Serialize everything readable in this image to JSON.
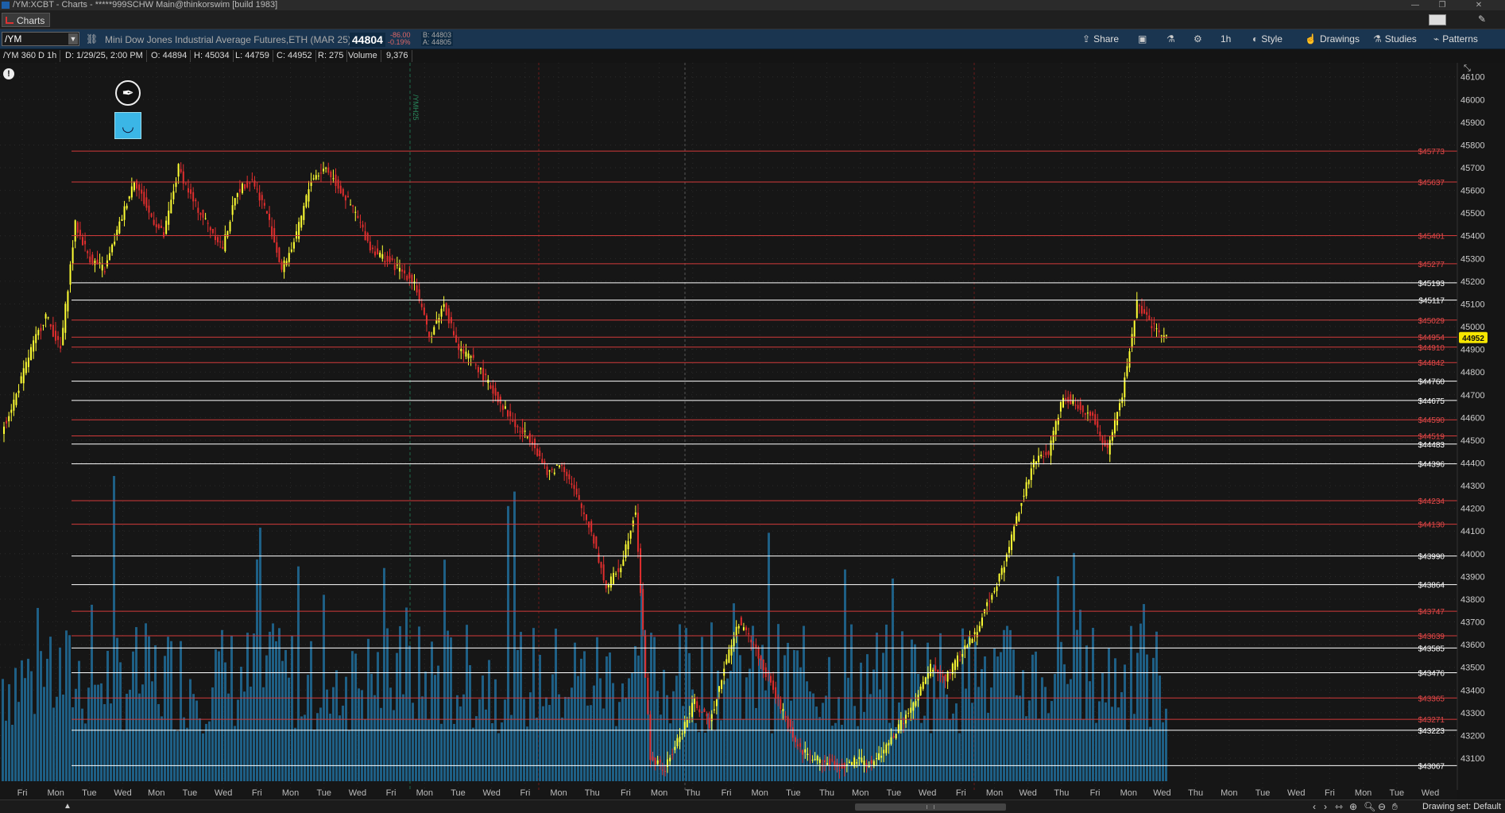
{
  "window": {
    "title": "/YM:XCBT - Charts - *****999SCHW Main@thinkorswim [build 1983]",
    "tab_label": "Charts"
  },
  "toolbar": {
    "symbol": "/YM",
    "description": "Mini Dow Jones Industrial Average Futures,ETH (MAR 25)",
    "last": "44804",
    "net_change": "-86.00",
    "pct_change": "-0.19%",
    "bid": "B: 44803",
    "ask": "A: 44805",
    "share_label": "Share",
    "timeframe_label": "1h",
    "style_label": "Style",
    "drawings_label": "Drawings",
    "studies_label": "Studies",
    "patterns_label": "Patterns"
  },
  "infobar": {
    "period": "/YM 360 D 1h",
    "date": "D: 1/29/25, 2:00 PM",
    "open": "O: 44894",
    "high": "H: 45034",
    "low": "L: 44759",
    "close": "C: 44952",
    "range": "R: 275",
    "volume_label": "Volume",
    "volume": "9,376"
  },
  "footer": {
    "drawing_set": "Drawing set: Default"
  },
  "colors": {
    "background": "#161616",
    "support_line": "#ffffff",
    "resistance_line": "#d23a3a",
    "up_candle": "#ffff33",
    "down_candle": "#e02e2e",
    "volume": "#1e5f85",
    "price_bubble": "#f7e600"
  },
  "chart_data": {
    "type": "candlestick",
    "y_axis": {
      "min": 43030,
      "max": 46120,
      "ticks": [
        46100,
        46000,
        45900,
        45800,
        45700,
        45600,
        45500,
        45400,
        45300,
        45200,
        45100,
        45000,
        44900,
        44800,
        44700,
        44600,
        44500,
        44400,
        44300,
        44200,
        44100,
        44000,
        43900,
        43800,
        43700,
        43600,
        43500,
        43400,
        43300,
        43200,
        43100
      ],
      "tick_labels": [
        "46100",
        "46000",
        "45900",
        "45800",
        "45700",
        "45600",
        "45500",
        "45400",
        "45300",
        "45200",
        "45100",
        "45000",
        "44900",
        "44800",
        "44700",
        "44600",
        "44500",
        "44400",
        "44300",
        "44200",
        "44100",
        "44000",
        "43900",
        "43800",
        "43700",
        "43600",
        "43500",
        "43400",
        "43300",
        "43200",
        "43100"
      ]
    },
    "x_labels": [
      "Fri",
      "Mon",
      "Tue",
      "Wed",
      "Mon",
      "Tue",
      "Wed",
      "Fri",
      "Mon",
      "Tue",
      "Wed",
      "Fri",
      "Mon",
      "Tue",
      "Wed",
      "Fri",
      "Mon",
      "Thu",
      "Fri",
      "Mon",
      "Thu",
      "Fri",
      "Mon",
      "Tue",
      "Thu",
      "Mon",
      "Tue",
      "Wed",
      "Fri",
      "Mon",
      "Wed",
      "Thu",
      "Fri",
      "Mon",
      "Wed",
      "Thu",
      "Mon",
      "Tue",
      "Wed",
      "Fri",
      "Mon",
      "Tue",
      "Wed"
    ],
    "current_price_bubble": 44952,
    "expiration_marker": "/YMH25",
    "key_levels": [
      {
        "value": 45773,
        "label": "$45773",
        "kind": "resistance"
      },
      {
        "value": 45637,
        "label": "$45637",
        "kind": "resistance"
      },
      {
        "value": 45401,
        "label": "$45401",
        "kind": "resistance"
      },
      {
        "value": 45277,
        "label": "$45277",
        "kind": "resistance"
      },
      {
        "value": 45193,
        "label": "$45193",
        "kind": "support"
      },
      {
        "value": 45117,
        "label": "$45117",
        "kind": "support"
      },
      {
        "value": 45029,
        "label": "$45029",
        "kind": "resistance"
      },
      {
        "value": 44954,
        "label": "$44954",
        "kind": "resistance"
      },
      {
        "value": 44910,
        "label": "$44910",
        "kind": "resistance"
      },
      {
        "value": 44842,
        "label": "$44842",
        "kind": "resistance"
      },
      {
        "value": 44760,
        "label": "$44760",
        "kind": "support"
      },
      {
        "value": 44675,
        "label": "$44675",
        "kind": "support"
      },
      {
        "value": 44590,
        "label": "$44590",
        "kind": "resistance"
      },
      {
        "value": 44519,
        "label": "$44519",
        "kind": "resistance"
      },
      {
        "value": 44483,
        "label": "$44483",
        "kind": "support"
      },
      {
        "value": 44396,
        "label": "$44396",
        "kind": "support"
      },
      {
        "value": 44234,
        "label": "$44234",
        "kind": "resistance"
      },
      {
        "value": 44130,
        "label": "$44130",
        "kind": "resistance"
      },
      {
        "value": 43990,
        "label": "$43990",
        "kind": "support"
      },
      {
        "value": 43864,
        "label": "$43864",
        "kind": "support"
      },
      {
        "value": 43747,
        "label": "$43747",
        "kind": "resistance"
      },
      {
        "value": 43639,
        "label": "$43639",
        "kind": "resistance"
      },
      {
        "value": 43585,
        "label": "$43585",
        "kind": "support"
      },
      {
        "value": 43476,
        "label": "$43476",
        "kind": "support"
      },
      {
        "value": 43365,
        "label": "$43365",
        "kind": "resistance"
      },
      {
        "value": 43271,
        "label": "$43271",
        "kind": "resistance"
      },
      {
        "value": 43223,
        "label": "$43223",
        "kind": "support"
      },
      {
        "value": 43067,
        "label": "$43067",
        "kind": "support"
      }
    ],
    "price_path": [
      44540,
      44700,
      44900,
      45050,
      44900,
      45450,
      45300,
      45250,
      45450,
      45650,
      45500,
      45400,
      45700,
      45550,
      45450,
      45350,
      45600,
      45650,
      45500,
      45250,
      45400,
      45650,
      45700,
      45600,
      45500,
      45350,
      45300,
      45250,
      45200,
      44950,
      45100,
      44900,
      44850,
      44750,
      44650,
      44550,
      44500,
      44350,
      44400,
      44250,
      44100,
      43850,
      43950,
      44200,
      43100,
      43050,
      43200,
      43350,
      43250,
      43500,
      43700,
      43600,
      43450,
      43300,
      43150,
      43100,
      43080,
      43060,
      43090,
      43070,
      43150,
      43250,
      43350,
      43500,
      43450,
      43550,
      43650,
      43800,
      43950,
      44200,
      44400,
      44450,
      44700,
      44650,
      44600,
      44450,
      44700,
      45100,
      45000,
      44950
    ],
    "volume_range": [
      0,
      160000
    ]
  }
}
